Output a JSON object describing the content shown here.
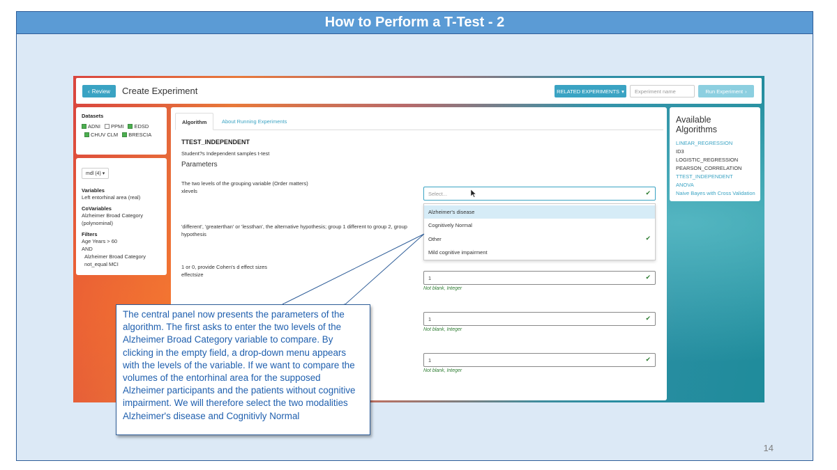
{
  "slide": {
    "title": "How to Perform a T-Test - 2",
    "page_number": "14",
    "callout_text": "The central panel now presents the parameters of the algorithm. The first asks to enter the two levels of the Alzheimer Broad Category variable to compare. By clicking in the empty field, a drop-down menu appears with the levels of the variable. If we want to compare the volumes of the entorhinal area for the supposed Alzheimer participants and the patients without cognitive impairment. We will therefore select the two modalities Alzheimer's disease and Cognitivly Normal"
  },
  "app": {
    "topbar": {
      "review_label": "Review",
      "page_title": "Create Experiment",
      "related_label": "RELATED EXPERIMENTS",
      "experiment_name_placeholder": "Experiment name",
      "run_label": "Run Experiment"
    },
    "datasets": {
      "title": "Datasets",
      "items": [
        {
          "label": "ADNI",
          "checked": true
        },
        {
          "label": "PPMI",
          "checked": false
        },
        {
          "label": "EDSD",
          "checked": true
        },
        {
          "label": "CHUV CLM",
          "checked": true
        },
        {
          "label": "BRESCIA",
          "checked": true
        }
      ]
    },
    "model": {
      "button_label": "mdl (4)",
      "variables_title": "Variables",
      "variable": "Left entorhinal area (real)",
      "covariables_title": "CoVariables",
      "covariable_line1": "Alzheimer Broad Category",
      "covariable_line2": "(polynominal)",
      "filters_title": "Filters",
      "filter_line1": "Age Years > 60",
      "filter_line2": "AND",
      "filter_line3": "Alzheimer Broad Category",
      "filter_line4": "not_equal MCI"
    },
    "main": {
      "tabs": [
        "Algorithm",
        "About Running Experiments"
      ],
      "algorithm_name": "TTEST_INDEPENDENT",
      "algorithm_desc": "Student?s Independent samples t-test",
      "parameters_heading": "Parameters",
      "params": [
        {
          "label": "The two levels of the grouping variable (Order matters)",
          "name": "xlevels",
          "placeholder": "Select..."
        },
        {
          "label": "'different', 'greaterthan' or 'lessthan', the alternative hypothesis; group 1 different to group 2, group",
          "name": "hypothesis"
        },
        {
          "label": "1 or 0, provide Cohen's d effect sizes",
          "name": "effectsize",
          "value": "1",
          "hint": "Not blank, Integer"
        }
      ],
      "extra_fields": [
        {
          "value": "1",
          "hint": "Not blank, Integer"
        },
        {
          "value": "1",
          "hint": "Not blank, Integer"
        }
      ],
      "dropdown_options": [
        {
          "label": "Alzheimer's disease",
          "highlighted": true,
          "checked": false
        },
        {
          "label": "Cognitively Normal",
          "highlighted": false,
          "checked": false
        },
        {
          "label": "Other",
          "highlighted": false,
          "checked": true
        },
        {
          "label": "Mild cognitive impairment",
          "highlighted": false,
          "checked": false
        }
      ]
    },
    "algorithms": {
      "title_line1": "Available",
      "title_line2": "Algorithms",
      "items": [
        {
          "label": "LINEAR_REGRESSION",
          "enabled": true
        },
        {
          "label": "ID3",
          "enabled": false
        },
        {
          "label": "LOGISTIC_REGRESSION",
          "enabled": false
        },
        {
          "label": "PEARSON_CORRELATION",
          "enabled": false
        },
        {
          "label": "TTEST_INDEPENDENT",
          "enabled": true
        },
        {
          "label": "ANOVA",
          "enabled": true
        },
        {
          "label": "Naive Bayes with Cross Validation",
          "enabled": true
        }
      ]
    }
  },
  "colors": {
    "title_bar": "#5b9bd5",
    "slide_bg": "#dce9f6",
    "accent": "#3aa3c3",
    "callout_text": "#1f5fae",
    "ok_green": "#2e7d32"
  }
}
